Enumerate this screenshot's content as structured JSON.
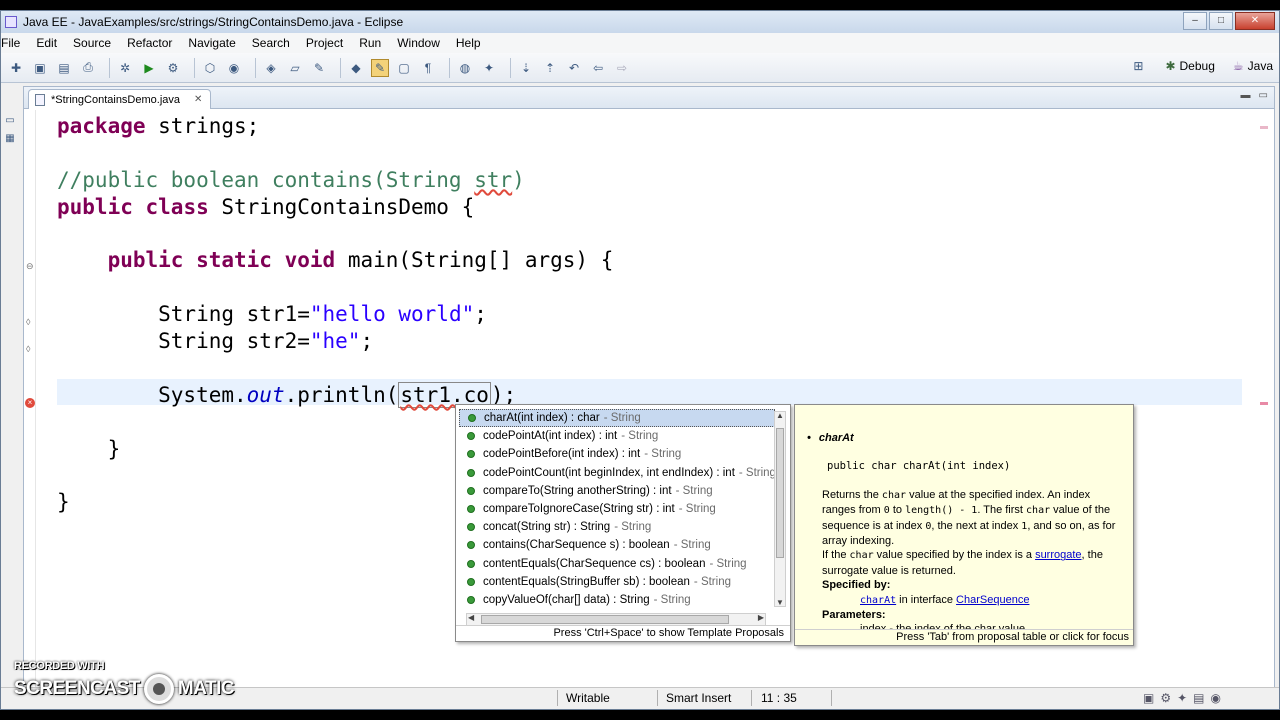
{
  "window": {
    "title": "Java EE - JavaExamples/src/strings/StringContainsDemo.java - Eclipse",
    "controls": {
      "minimize": "–",
      "maximize": "□",
      "close": "✕"
    }
  },
  "menu": [
    "File",
    "Edit",
    "Source",
    "Refactor",
    "Navigate",
    "Search",
    "Project",
    "Run",
    "Window",
    "Help"
  ],
  "toolbar": {
    "perspectives": {
      "debug": "Debug",
      "java": "Java"
    }
  },
  "editor": {
    "tab_label": "*StringContainsDemo.java",
    "tab_close": "✕",
    "code": {
      "l1_kw": "package",
      "l1_rest": " strings;",
      "l3_comment_a": "//public boolean contains(String ",
      "l3_comment_b": "str",
      "l3_comment_c": ")",
      "l4_kw1": "public",
      "l4_kw2": "class",
      "l4_rest": " StringContainsDemo {",
      "l6_indent": "    ",
      "l6_kw1": "public",
      "l6_kw2": "static",
      "l6_kw3": "void",
      "l6_rest": " main(String[] args) {",
      "l8_a": "        String str1=",
      "l8_str": "\"hello world\"",
      "l8_b": ";",
      "l9_a": "        String str2=",
      "l9_str": "\"he\"",
      "l9_b": ";",
      "l11_a": "        System.",
      "l11_out": "out",
      "l11_b": ".println(",
      "l11_typed": "str1.co",
      "l11_c": ");",
      "l13": "    }",
      "l15": "}"
    }
  },
  "content_assist": {
    "proposals": [
      {
        "sig": "charAt(int index) : char",
        "owner": "- String"
      },
      {
        "sig": "codePointAt(int index) : int",
        "owner": "- String"
      },
      {
        "sig": "codePointBefore(int index) : int",
        "owner": "- String"
      },
      {
        "sig": "codePointCount(int beginIndex, int endIndex) : int",
        "owner": "- String"
      },
      {
        "sig": "compareTo(String anotherString) : int",
        "owner": "- String"
      },
      {
        "sig": "compareToIgnoreCase(String str) : int",
        "owner": "- String"
      },
      {
        "sig": "concat(String str) : String",
        "owner": "- String"
      },
      {
        "sig": "contains(CharSequence s) : boolean",
        "owner": "- String"
      },
      {
        "sig": "contentEquals(CharSequence cs) : boolean",
        "owner": "- String"
      },
      {
        "sig": "contentEquals(StringBuffer sb) : boolean",
        "owner": "- String"
      },
      {
        "sig": "copyValueOf(char[] data) : String",
        "owner": "- String"
      }
    ],
    "status": "Press 'Ctrl+Space' to show Template Proposals"
  },
  "javadoc": {
    "method_name": "charAt",
    "signature": "public char charAt(int index)",
    "p1_a": "Returns the ",
    "p1_code1": "char",
    "p1_b": " value at the specified index. An index ranges from ",
    "p1_code2": "0",
    "p1_c": " to ",
    "p1_code3": "length() - 1",
    "p1_d": ". The first ",
    "p1_code4": "char",
    "p1_e": " value of the sequence is at index ",
    "p1_code5": "0",
    "p1_f": ", the next at index ",
    "p1_code6": "1",
    "p1_g": ", and so on, as for array indexing.",
    "p2_a": "If the ",
    "p2_code": "char",
    "p2_b": " value specified by the index is a ",
    "p2_link": "surrogate",
    "p2_c": ", the surrogate value is returned.",
    "specified_by_label": "Specified by:",
    "specified_link1": "charAt",
    "specified_mid": " in interface ",
    "specified_link2": "CharSequence",
    "parameters_label": "Parameters:",
    "param_partial": "index - the index of the char value.",
    "status": "Press 'Tab' from proposal table or click for focus"
  },
  "statusbar": {
    "writable": "Writable",
    "insert_mode": "Smart Insert",
    "position": "11 : 35"
  },
  "watermark": {
    "line1": "RECORDED WITH",
    "line2a": "SCREENCAST",
    "line2b": "MATIC"
  }
}
